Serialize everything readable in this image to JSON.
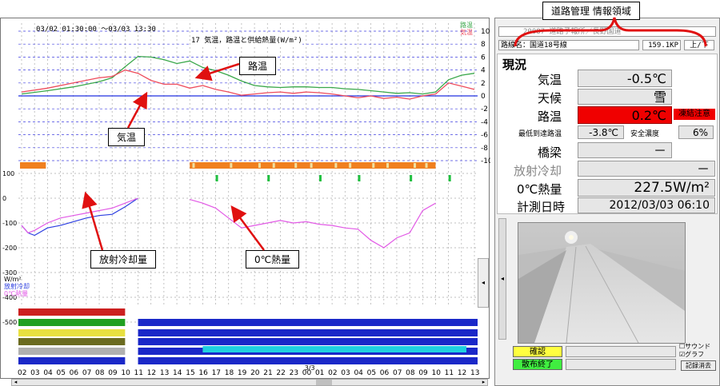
{
  "annotations": {
    "road_mgmt": "道路管理 情報領域",
    "road_temp": "路温",
    "air_temp": "気温",
    "radiative": "放射冷却量",
    "heat0": "0℃熱量"
  },
  "chart": {
    "date_range": "03/02 01:30:00 ～03/03 13:30",
    "title": "17 気温，路温と供給熱量(W/m²)",
    "legend_corner": [
      "路温",
      "気温"
    ],
    "y_right_ticks": [
      "10",
      "8",
      "6",
      "4",
      "2",
      "0",
      "-2",
      "-4",
      "-6",
      "-8",
      "-10"
    ],
    "y_left_ticks": [
      "100",
      "0",
      "-100",
      "-200",
      "-300",
      "-400",
      "-500"
    ],
    "unit_legend": [
      "W/m²",
      "放射冷却",
      "0℃熱量"
    ],
    "x_ticks": [
      "02",
      "03",
      "04",
      "05",
      "06",
      "07",
      "08",
      "09",
      "10",
      "11",
      "12",
      "13",
      "14",
      "15",
      "16",
      "17",
      "18",
      "19",
      "20",
      "21",
      "22",
      "23",
      "00",
      "01",
      "02",
      "03",
      "04",
      "05",
      "06",
      "07",
      "08",
      "09",
      "10",
      "11",
      "12",
      "13"
    ],
    "x_date_label": "3/3",
    "colors": {
      "road": "#3aa84a",
      "air": "#ee4c5c",
      "radiative": "#2d3fe0",
      "heat0": "#e25ae6"
    }
  },
  "panel": {
    "header_left": "20087 道路予報所／長野国道",
    "route": "路線名：国道18号線",
    "kp": "159.1KP",
    "direction": "上/下",
    "genkyo": "現況",
    "air_temp_label": "気温",
    "air_temp_value": "-0.5℃",
    "weather_label": "天候",
    "weather_value": "雪",
    "road_temp_label": "路温",
    "road_temp_value": "0.2℃",
    "freeze_warning": "凍結注意",
    "min_road_label": "最低到達路温",
    "min_road_value": "-3.8℃",
    "safe_conc_label": "安全濃度",
    "safe_conc_value": "6%",
    "bridge_label": "橋梁",
    "bridge_value": "－",
    "radiative_label": "放射冷却",
    "radiative_value": "－",
    "heat0_label": "0℃熱量",
    "heat0_value": "227.5W/m²",
    "measured_label": "計測日時",
    "measured_value": "2012/03/03 06:10"
  },
  "controls": {
    "confirm": "確認",
    "spray_done": "散布終了",
    "sound": "サウンド",
    "graph": "グラフ",
    "clear_log": "記録消去"
  }
}
